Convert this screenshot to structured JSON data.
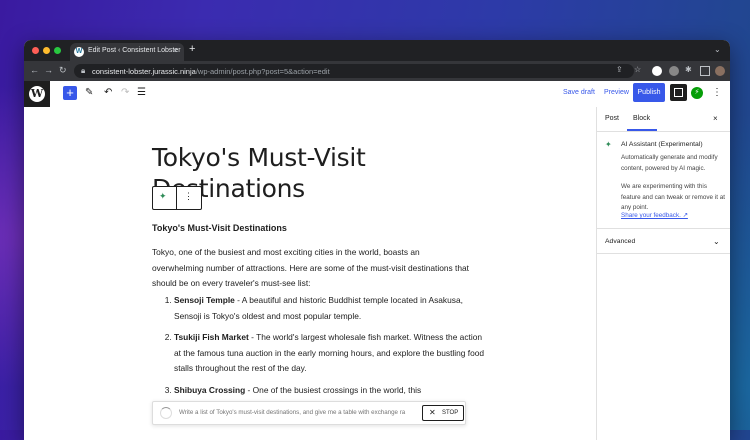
{
  "browser": {
    "tab_title": "Edit Post ‹ Consistent Lobster",
    "tab_close": "×",
    "new_tab": "+",
    "url_host": "consistent-lobster.jurassic.ninja",
    "url_path": "/wp-admin/post.php?post=5&action=edit",
    "nav": {
      "back": "←",
      "forward": "→",
      "reload": "↻"
    },
    "traffic_light_colors": [
      "#ff5f57",
      "#febc2e",
      "#28c840"
    ]
  },
  "toolbar": {
    "wp_logo": "W",
    "add_block": "+",
    "save_draft": "Save draft",
    "preview": "Preview",
    "publish": "Publish",
    "more": "⋮",
    "accent": "#3858e9"
  },
  "post": {
    "title": "Tokyo's Must-Visit Destinations",
    "heading": "Tokyo's Must-Visit Destinations",
    "intro": "Tokyo, one of the busiest and most exciting cities in the world, boasts an overwhelming number of attractions. Here are some of the must-visit destinations that should be on every traveler's must-see list:",
    "list": [
      {
        "name": "Sensoji Temple",
        "text": " - A beautiful and historic Buddhist temple located in Asakusa, Sensoji is Tokyo's oldest and most popular temple."
      },
      {
        "name": "Tsukiji Fish Market",
        "text": " - The world's largest wholesale fish market. Witness the action at the famous tuna auction in the early morning hours, and explore the bustling food stalls throughout the rest of the day."
      },
      {
        "name": "Shibuya Crossing",
        "text": " - One of the busiest crossings in the world, this"
      }
    ]
  },
  "ai_prompt": {
    "text": "Write a list of Tokyo's must-visit destinations, and give me a table with exchange ra",
    "stop_label": "STOP",
    "stop_icon": "✕"
  },
  "sidebar": {
    "tab_post": "Post",
    "tab_block": "Block",
    "close": "×",
    "block_name": "AI Assistant (Experimental)",
    "block_desc": "Automatically generate and modify content, powered by AI magic.",
    "block_note": "We are experimenting with this feature and can tweak or remove it at any point.",
    "feedback_link": "Share your feedback. ↗",
    "advanced": "Advanced",
    "advanced_chevron": "⌄"
  }
}
